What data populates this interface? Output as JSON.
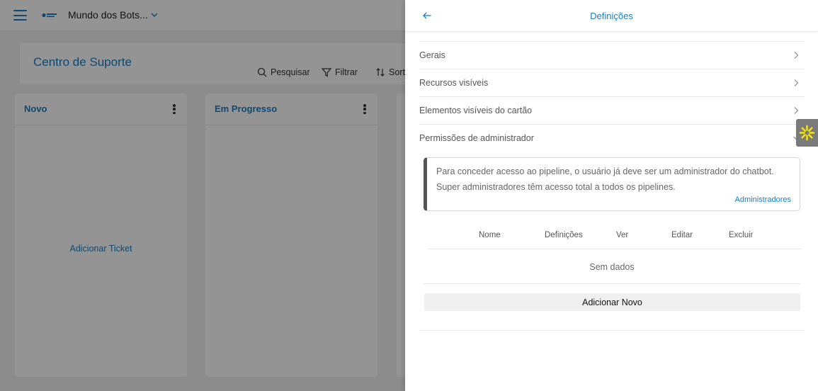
{
  "app": {
    "workspace_name": "Mundo dos Bots...",
    "icons": {
      "menu": "hamburger-icon",
      "logo": "brand-logo",
      "dropdown": "chevron-down-icon"
    }
  },
  "board": {
    "title": "Centro de Suporte",
    "toolbar": {
      "search_label": "Pesquisar",
      "filter_label": "Filtrar",
      "sort_label": "Sort"
    },
    "columns": [
      {
        "title": "Novo",
        "add_label": "Adicionar Ticket"
      },
      {
        "title": "Em Progresso"
      }
    ]
  },
  "drawer": {
    "title": "Definições",
    "sections": [
      "Gerais",
      "Recursos visíveis",
      "Elementos visíveis do cartão",
      "Permissões de administrador"
    ],
    "info": {
      "text": "Para conceder acesso ao pipeline, o usuário já deve ser um administrador do chatbot. Super administradores têm acesso total a todos os pipelines.",
      "link": "Administradores"
    },
    "table": {
      "headers": [
        "Nome",
        "Definições",
        "Ver",
        "Editar",
        "Excluir"
      ],
      "empty": "Sem dados"
    },
    "add_button": "Adicionar Novo"
  },
  "colors": {
    "accent": "#1a7fc1",
    "overlay": "rgba(0,0,0,0.42)",
    "widget_flower": "#f5e50a"
  }
}
